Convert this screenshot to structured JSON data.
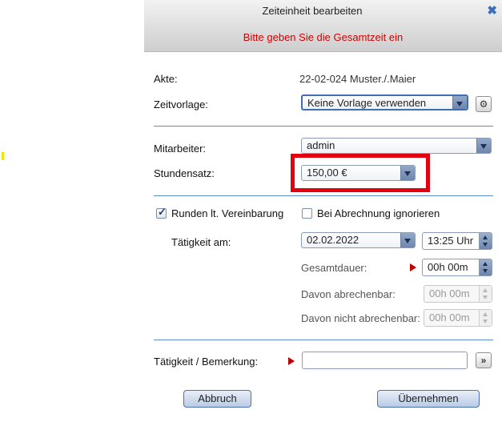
{
  "dialog": {
    "title": "Zeiteinheit bearbeiten",
    "warning": "Bitte geben Sie die Gesamtzeit ein",
    "close_icon": "close-icon"
  },
  "form": {
    "akte_label": "Akte:",
    "akte_value": "22-02-024 Muster./.Maier",
    "zeitvorlage_label": "Zeitvorlage:",
    "zeitvorlage_value": "Keine Vorlage verwenden",
    "mitarbeiter_label": "Mitarbeiter:",
    "mitarbeiter_value": "admin",
    "stundensatz_label": "Stundensatz:",
    "stundensatz_value": "150,00 €",
    "runden_label": "Runden lt. Vereinbarung",
    "runden_checked": true,
    "ignorieren_label": "Bei Abrechnung ignorieren",
    "ignorieren_checked": false,
    "taetigkeit_am_label": "Tätigkeit am:",
    "datum_value": "02.02.2022",
    "uhrzeit_value": "13:25 Uhr",
    "gesamtdauer_label": "Gesamtdauer:",
    "gesamtdauer_value": "00h 00m",
    "abrechenbar_label": "Davon abrechenbar:",
    "abrechenbar_value": "00h 00m",
    "nicht_abrechenbar_label": "Davon nicht abrechenbar:",
    "nicht_abrechenbar_value": "00h 00m",
    "bemerkung_label": "Tätigkeit / Bemerkung:",
    "bemerkung_value": ""
  },
  "buttons": {
    "abbruch": "Abbruch",
    "uebernehmen": "Übernehmen",
    "expand_glyph": "»"
  },
  "colors": {
    "warning": "#d40000",
    "highlight": "#e3000f",
    "accent": "#5d8cc7"
  }
}
